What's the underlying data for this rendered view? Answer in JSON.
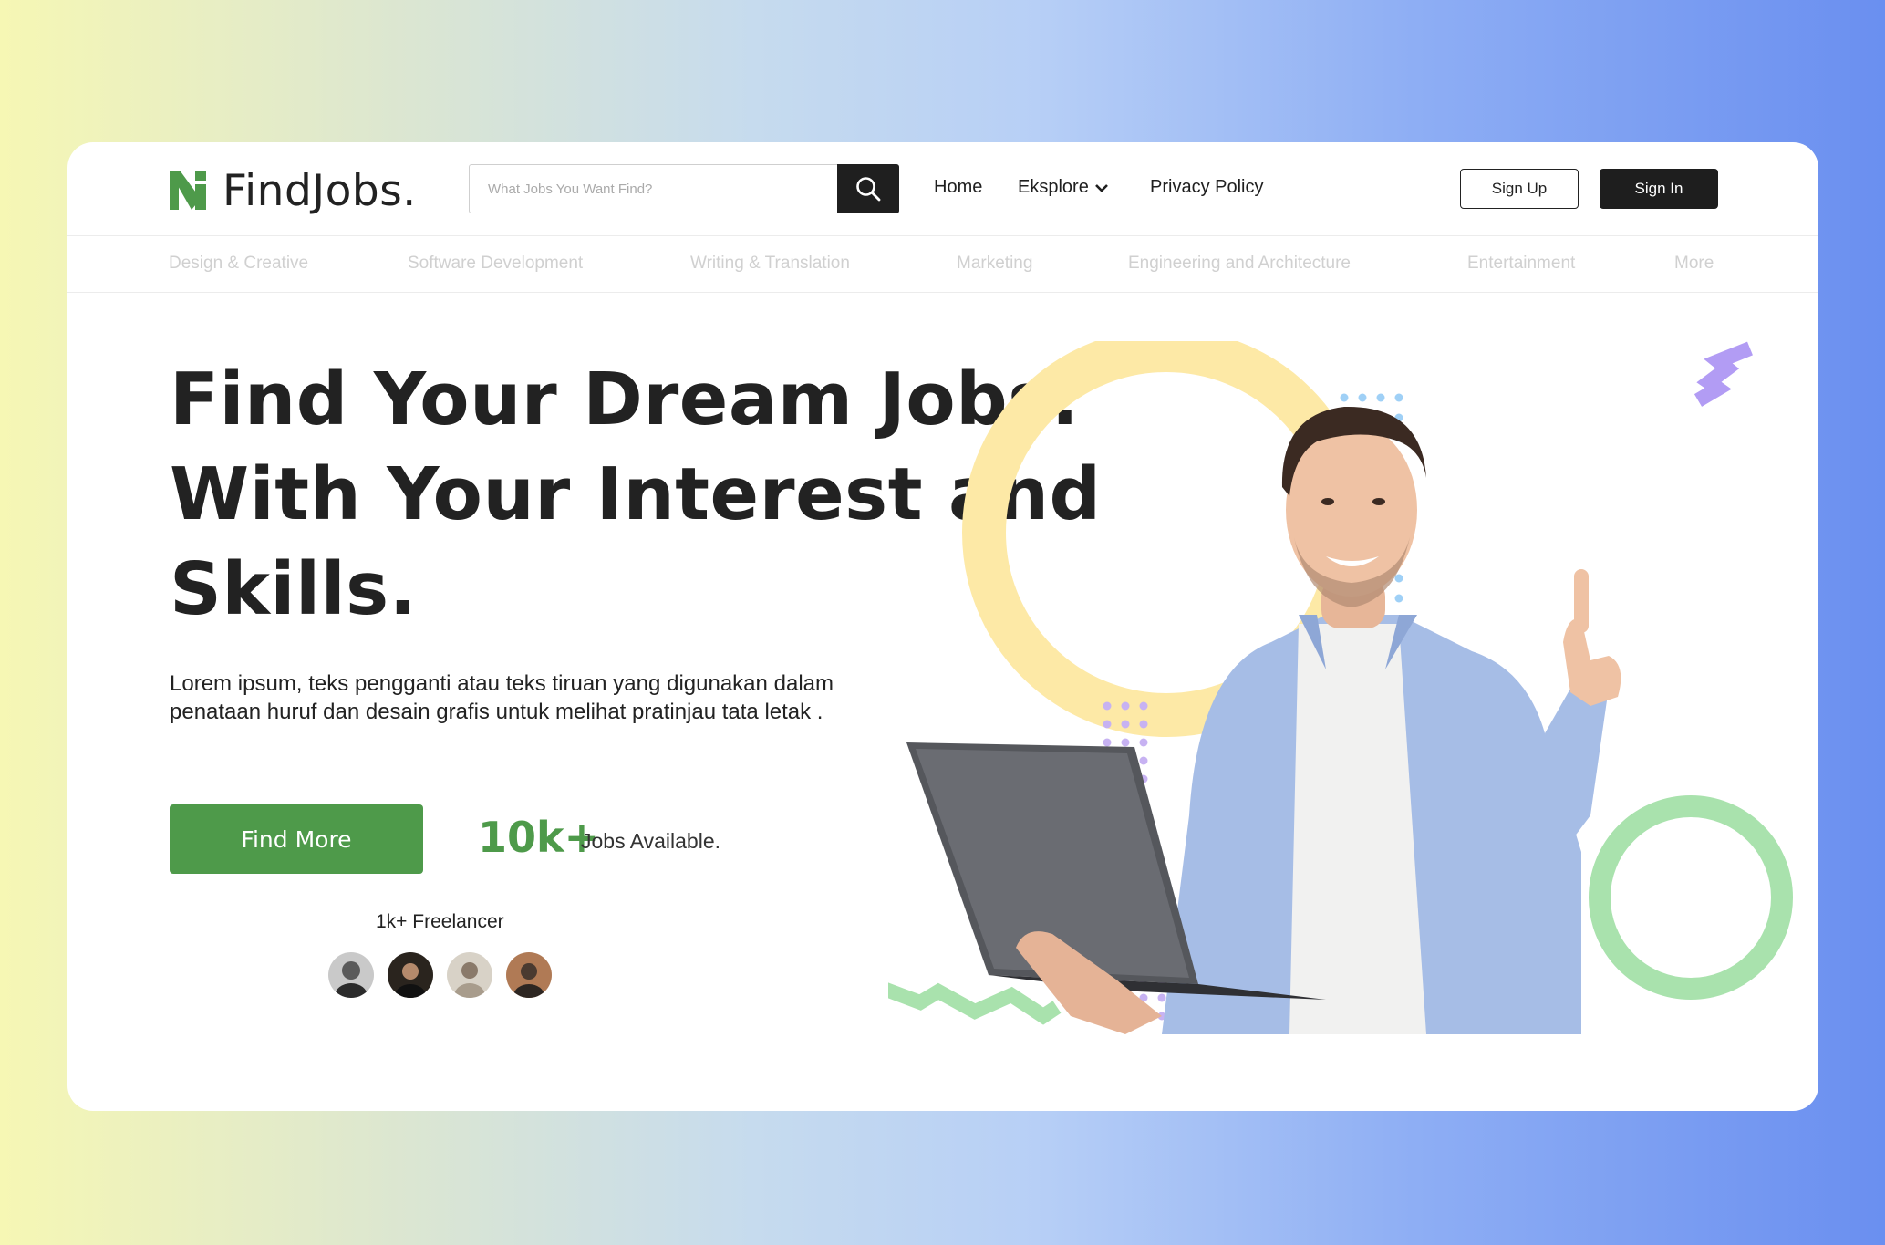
{
  "brand": {
    "name": "FindJobs.",
    "accent": "#4e9a4a"
  },
  "search": {
    "placeholder": "What Jobs You Want Find?",
    "icon": "search-icon"
  },
  "nav": {
    "home": "Home",
    "explore": "Eksplore",
    "privacy": "Privacy Policy"
  },
  "auth": {
    "signup": "Sign Up",
    "signin": "Sign In"
  },
  "categories": [
    "Design & Creative",
    "Software Development",
    "Writing & Translation",
    "Marketing",
    "Engineering and Architecture",
    "Entertainment",
    "More"
  ],
  "hero": {
    "title_lines": [
      "Find Your Dream Jobs.",
      "With Your Interest and",
      "Skills."
    ],
    "description": "Lorem ipsum, teks pengganti atau teks tiruan yang digunakan dalam penataan huruf dan desain grafis untuk melihat pratinjau tata letak .",
    "cta": "Find More",
    "stat_number": "10k+",
    "stat_label": "Jobs Available.",
    "freelancer_label": "1k+ Freelancer"
  },
  "colors": {
    "dark": "#1f1f1f",
    "yellow_ring": "#fde9a6",
    "dots_blue": "#9fd0f6",
    "dots_purple": "#c7b2f2",
    "zigzag_green": "#a9e2ad",
    "zigzag_purple": "#b29cf4",
    "green_ring": "#a9e2ad"
  }
}
